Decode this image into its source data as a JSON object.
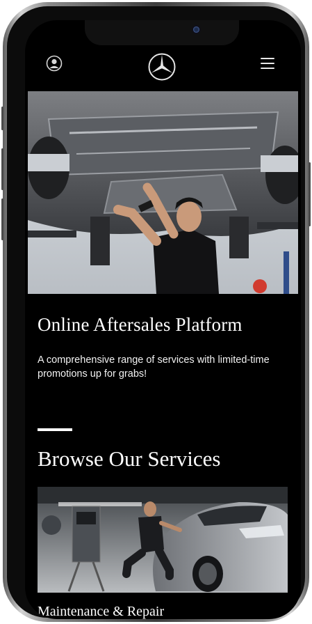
{
  "header": {
    "user_icon": "user-circle-icon",
    "logo": "three-pointed-star-logo",
    "menu_icon": "hamburger-menu-icon"
  },
  "hero": {
    "image": "technician-working-under-vehicle-photo",
    "title": "Online Aftersales Platform",
    "description": "A comprehensive range of services with limited-time promotions up for grabs!"
  },
  "services": {
    "heading": "Browse Our Services",
    "cards": [
      {
        "image": "technician-servicing-car-photo",
        "label": "Maintenance & Repair"
      }
    ]
  },
  "colors": {
    "background": "#000000",
    "text": "#ffffff",
    "accent_bar": "#ffffff"
  }
}
